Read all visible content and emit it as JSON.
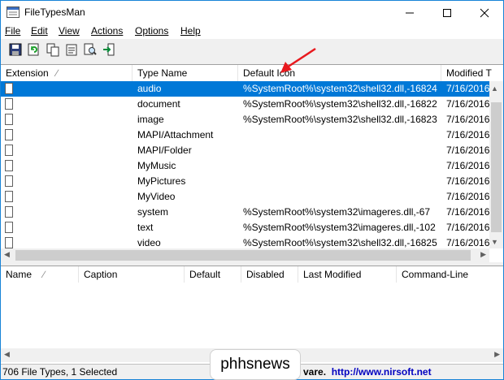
{
  "window": {
    "title": "FileTypesMan"
  },
  "menu": [
    {
      "label": "File",
      "name": "menu-file"
    },
    {
      "label": "Edit",
      "name": "menu-edit"
    },
    {
      "label": "View",
      "name": "menu-view"
    },
    {
      "label": "Actions",
      "name": "menu-actions"
    },
    {
      "label": "Options",
      "name": "menu-options"
    },
    {
      "label": "Help",
      "name": "menu-help"
    }
  ],
  "toolbar_icons": [
    "save-icon",
    "refresh-icon",
    "copy-icon",
    "properties-icon",
    "find-icon",
    "exit-icon"
  ],
  "top_table": {
    "headers": [
      "Extension",
      "Type Name",
      "Default Icon",
      "Modified T"
    ],
    "rows": [
      {
        "ext": "",
        "type": "audio",
        "icon": "%SystemRoot%\\system32\\shell32.dll,-16824",
        "modified": "7/16/2016",
        "selected": true
      },
      {
        "ext": "",
        "type": "document",
        "icon": "%SystemRoot%\\system32\\shell32.dll,-16822",
        "modified": "7/16/2016"
      },
      {
        "ext": "",
        "type": "image",
        "icon": "%SystemRoot%\\system32\\shell32.dll,-16823",
        "modified": "7/16/2016"
      },
      {
        "ext": "",
        "type": "MAPI/Attachment",
        "icon": "",
        "modified": "7/16/2016"
      },
      {
        "ext": "",
        "type": "MAPI/Folder",
        "icon": "",
        "modified": "7/16/2016"
      },
      {
        "ext": "",
        "type": "MyMusic",
        "icon": "",
        "modified": "7/16/2016"
      },
      {
        "ext": "",
        "type": "MyPictures",
        "icon": "",
        "modified": "7/16/2016"
      },
      {
        "ext": "",
        "type": "MyVideo",
        "icon": "",
        "modified": "7/16/2016"
      },
      {
        "ext": "",
        "type": "system",
        "icon": "%SystemRoot%\\system32\\imageres.dll,-67",
        "modified": "7/16/2016"
      },
      {
        "ext": "",
        "type": "text",
        "icon": "%SystemRoot%\\system32\\imageres.dll,-102",
        "modified": "7/16/2016"
      },
      {
        "ext": "",
        "type": "video",
        "icon": "%SystemRoot%\\system32\\shell32.dll,-16825",
        "modified": "7/16/2016"
      }
    ]
  },
  "bottom_table": {
    "headers": [
      "Name",
      "Caption",
      "Default",
      "Disabled",
      "Last Modified",
      "Command-Line"
    ]
  },
  "status": {
    "left": "706 File Types, 1 Selected",
    "right_prefix": "vare.",
    "right_link": "http://www.nirsoft.net"
  },
  "watermark": "phhsnews",
  "colors": {
    "selection": "#0078d7",
    "annotation_arrow": "#e8191e"
  }
}
